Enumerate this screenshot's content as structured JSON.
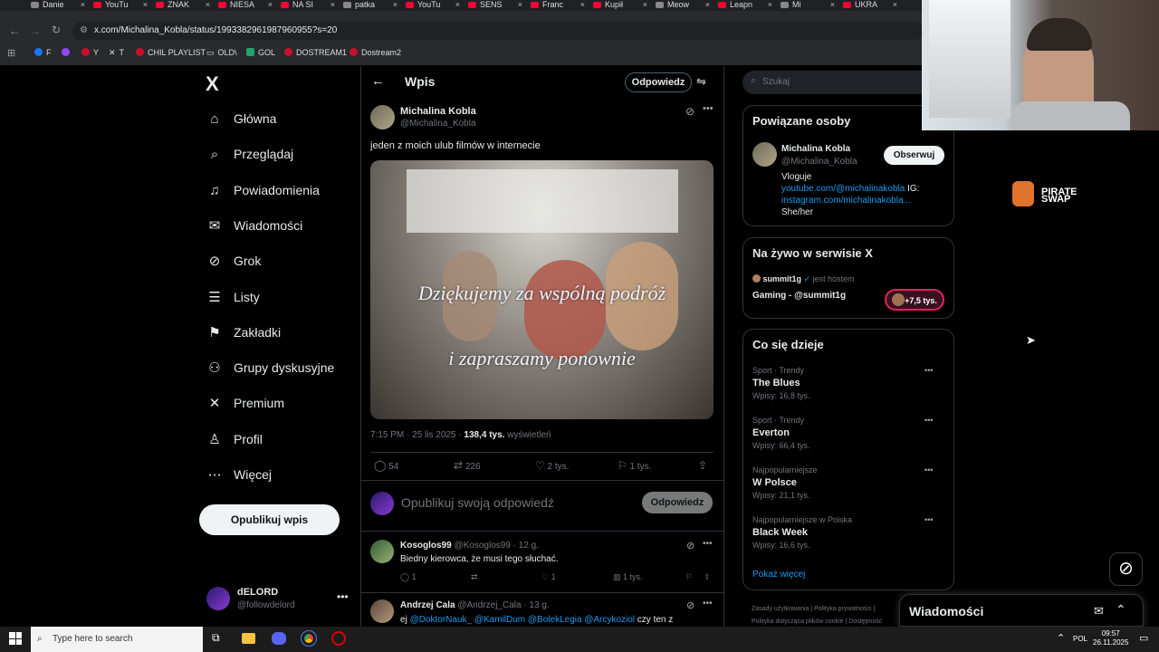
{
  "tabs": [
    {
      "label": "Danie",
      "color": "#888"
    },
    {
      "label": "YouTu",
      "color": "#ff0033"
    },
    {
      "label": "ZNAK",
      "color": "#ff0033"
    },
    {
      "label": "NIESA",
      "color": "#ff0033"
    },
    {
      "label": "NA SI",
      "color": "#ff0033"
    },
    {
      "label": "patka",
      "color": "#888"
    },
    {
      "label": "YouTu",
      "color": "#ff0033"
    },
    {
      "label": "SENS",
      "color": "#ff0033"
    },
    {
      "label": "Franc",
      "color": "#ff0033"
    },
    {
      "label": "Kupił",
      "color": "#ff0033"
    },
    {
      "label": "Meow",
      "color": "#888"
    },
    {
      "label": "Leapn",
      "color": "#ff0033"
    },
    {
      "label": "Mi",
      "color": "#888"
    },
    {
      "label": "UKRA",
      "color": "#ff0033"
    }
  ],
  "browser": {
    "url": "x.com/Michalina_Kobla/status/1993382961987960955?s=20"
  },
  "bookmarks": [
    "F",
    "",
    "Y",
    "T",
    "CHIL PLAYLIST",
    "OLD\\",
    "GOL",
    "DOSTREAM1",
    "Dostream2"
  ],
  "nav": {
    "logo": "X",
    "items": [
      {
        "label": "Główna",
        "icon": "home-icon",
        "glyph": "⌂"
      },
      {
        "label": "Przeglądaj",
        "icon": "search-icon",
        "glyph": "⌕"
      },
      {
        "label": "Powiadomienia",
        "icon": "bell-icon",
        "glyph": "♫"
      },
      {
        "label": "Wiadomości",
        "icon": "mail-icon",
        "glyph": "✉"
      },
      {
        "label": "Grok",
        "icon": "grok-icon",
        "glyph": "⊘"
      },
      {
        "label": "Listy",
        "icon": "list-icon",
        "glyph": "☰"
      },
      {
        "label": "Zakładki",
        "icon": "bookmark-icon",
        "glyph": "⚑"
      },
      {
        "label": "Grupy dyskusyjne",
        "icon": "people-icon",
        "glyph": "⚇"
      },
      {
        "label": "Premium",
        "icon": "x-premium-icon",
        "glyph": "✕"
      },
      {
        "label": "Profil",
        "icon": "profile-icon",
        "glyph": "♙"
      },
      {
        "label": "Więcej",
        "icon": "more-icon",
        "glyph": "⋯"
      }
    ],
    "post_button": "Opublikuj wpis",
    "account": {
      "name": "dELORD",
      "handle": "@followdelord"
    }
  },
  "post": {
    "header_title": "Wpis",
    "reply_top_button": "Odpowiedz",
    "author_name": "Michalina Kobla",
    "author_handle": "@Michalina_Kobla",
    "text": "jeden z moich ulub filmów w internecie",
    "video_caption_1": "Dziękujemy za wspólną podróż",
    "video_caption_2": "i zapraszamy ponownie",
    "timestamp": "7:15 PM · 25 lis 2025 · ",
    "views_count": "138,4 tys.",
    "views_label": " wyświetleń",
    "replies": "54",
    "reposts": "226",
    "likes": "2 tys.",
    "bookmarks": "1 tys.",
    "reply_placeholder": "Opublikuj swoją odpowiedź",
    "reply_button": "Odpowiedz"
  },
  "replies": [
    {
      "name": "Kosoglos99",
      "handle": "@Kosoglos99",
      "time": "· 12 g.",
      "text": "Biedny kierowca, że musi tego słuchać.",
      "replies": "1",
      "reposts": "",
      "likes": "1",
      "views": "1 tys."
    },
    {
      "name": "Andrzej Cala",
      "handle": "@Andrzej_Cala",
      "time": "· 13 g.",
      "text_prefix": "ej ",
      "mentions": "@DoktorNauk_ @KamilDum @BolekLegia @Arcykoziol",
      "text_suffix": " czy ten z"
    }
  ],
  "right": {
    "search_placeholder": "Szukaj",
    "related_title": "Powiązane osoby",
    "related": {
      "name": "Michalina Kobla",
      "handle": "@Michalina_Kobla",
      "follow_button": "Obserwuj",
      "bio_line1": "Vloguje",
      "bio_link1": "youtube.com/@michalinakobla",
      "bio_ig": " IG:",
      "bio_link2": "instagram.com/michalinakobla...",
      "bio_line3": "She/her"
    },
    "live_title": "Na żywo w serwisie X",
    "live": {
      "host": "summit1g",
      "host_suffix": "jest hostem",
      "title": "Gaming - @summit1g",
      "listeners": "+7,5 tys."
    },
    "trends_title": "Co się dzieje",
    "trends": [
      {
        "category": "Sport · Trendy",
        "title": "The Blues",
        "count": "Wpisy: 16,8 tys."
      },
      {
        "category": "Sport · Trendy",
        "title": "Everton",
        "count": "Wpisy: 66,4 tys."
      },
      {
        "category": "Najpopularniejsze",
        "title": "W Polsce",
        "count": "Wpisy: 21,1 tys."
      },
      {
        "category": "Najpopularniejsze w Polska",
        "title": "Black Week",
        "count": "Wpisy: 16,6 tys."
      }
    ],
    "show_more": "Pokaż więcej",
    "footer_1": "Zasady użytkowania   |   Polityka prywatności   |",
    "footer_2": "Polityka dotycząca plików cookie   |   Dostępność",
    "messages_dock": "Wiadomości"
  },
  "overlay": {
    "brand_line1": "PIRATE",
    "brand_line2": "SWAP"
  },
  "taskbar": {
    "search_placeholder": "Type here to search",
    "lang": "POL",
    "time": "09:57",
    "date": "26.11.2025"
  }
}
